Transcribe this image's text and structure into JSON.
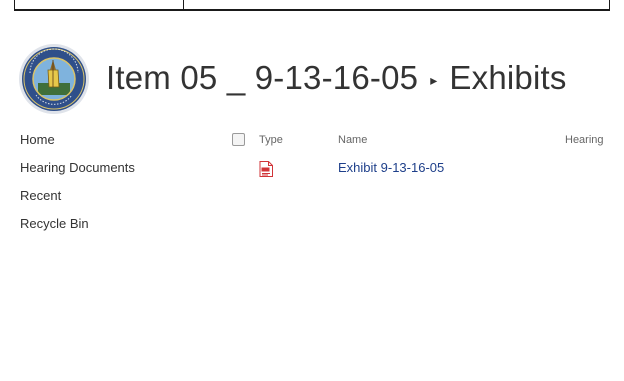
{
  "header": {
    "logo_icon": "state-seal-logo",
    "title_item": "Item 05 _ 9-13-16-05",
    "separator": "▸",
    "title_library": "Exhibits"
  },
  "nav": {
    "items": [
      {
        "label": "Home"
      },
      {
        "label": "Hearing Documents"
      },
      {
        "label": "Recent"
      },
      {
        "label": "Recycle Bin"
      }
    ]
  },
  "list": {
    "columns": {
      "select_icon": "checkbox",
      "type": "Type",
      "name": "Name",
      "hearing": "Hearing"
    },
    "rows": [
      {
        "type_icon": "pdf-icon",
        "name": "Exhibit 9-13-16-05"
      }
    ]
  },
  "colors": {
    "link": "#1e3f8a",
    "text": "#333333",
    "pdf": "#d13438"
  }
}
